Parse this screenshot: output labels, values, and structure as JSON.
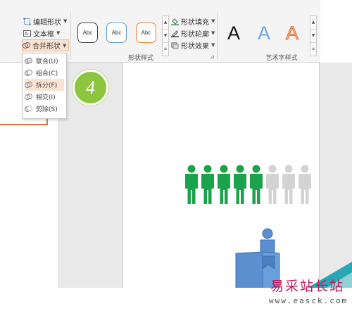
{
  "ribbon": {
    "buttons": {
      "edit_shape": "编辑形状",
      "text_box": "文本框",
      "merge_shapes": "合并形状"
    },
    "shape_styles": [
      "Abc",
      "Abc",
      "Abc"
    ],
    "shape_style_colors": [
      "#444444",
      "#5b9bd5",
      "#ed7d31"
    ],
    "fill_label": "形状填充",
    "outline_label": "形状轮廓",
    "effects_label": "形状效果",
    "shape_style_group": "形状样式",
    "art_letters": [
      "A",
      "A",
      "A"
    ],
    "art_colors": [
      "#111111",
      "#6fa8dc",
      "#f08a4b"
    ],
    "art_text_group": "艺术字样式"
  },
  "merge_menu": {
    "items": [
      {
        "label": "联合(U)",
        "icon": "union-icon"
      },
      {
        "label": "组合(C)",
        "icon": "combine-icon"
      },
      {
        "label": "拆分(F)",
        "icon": "fragment-icon",
        "highlighted": true
      },
      {
        "label": "相交(I)",
        "icon": "intersect-icon"
      },
      {
        "label": "剪除(S)",
        "icon": "subtract-icon"
      }
    ]
  },
  "step_badge": "4",
  "people_chart": {
    "filled": 5,
    "total": 8,
    "filled_color": "#1aa34a",
    "empty_color": "#d3d3d3"
  },
  "shape_color": "#5b8fd0",
  "watermark": {
    "text": "易采站长站",
    "url": "www.easck.com"
  }
}
